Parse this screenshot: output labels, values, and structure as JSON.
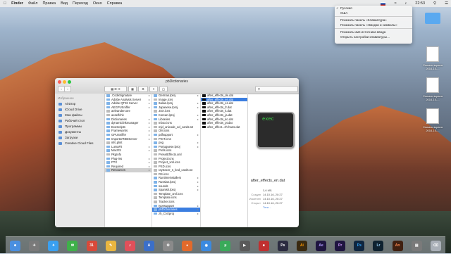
{
  "menubar": {
    "apple": "",
    "items": [
      "Finder",
      "Файл",
      "Правка",
      "Вид",
      "Переход",
      "Окно",
      "Справка"
    ],
    "clock": "22:53"
  },
  "input_menu": {
    "items": [
      "Русская",
      "США"
    ],
    "actions": [
      "Показать панель «Клавиатура»",
      "Показать панель «Эмодзи и символы»",
      "Показать имя источника ввода",
      "Открыть настройки клавиатуры…"
    ]
  },
  "desktop_icons": [
    {
      "label": "Снимок экрана 2016-10-..."
    },
    {
      "label": "Снимок экрана 2016-10-..."
    },
    {
      "label": "Снимок экрана 2016-10-..."
    }
  ],
  "finder": {
    "title": "pbDictionaries",
    "sidebar": {
      "header": "Избранное",
      "items": [
        "AirDrop",
        "iCloud Drive",
        "Мои файлы",
        "Рабочий стол",
        "Программы",
        "Документы",
        "Загрузки",
        "Creative Cloud Files"
      ]
    },
    "col1": [
      ".CodeSignature",
      "Adobe Analysis Server",
      "Adobe QT32 Server",
      "AEGPUSniffer",
      "aeleandercore",
      "aeselfchk",
      "Dictionaries",
      "dynamiclinkmanager",
      "ExeScripts",
      "Frameworks",
      "GPUSniffer",
      "ImporterREDServer",
      "info.plist",
      "LumaFit",
      "MacOS",
      "PkgInfo",
      "Plug-ins",
      "PTX",
      "Required",
      "Resources"
    ],
    "col2": [
      "German.lproj",
      "Image.icns",
      "Italian.lproj",
      "Japanese.lproj",
      "JSX.icns",
      "Korean.lproj",
      "Libraries",
      "Inbox.icns",
      "mjd_unicode_ed_cards.txt",
      "OM.icns",
      "pdfsupport",
      "PICT.icns",
      "png",
      "Portuguese.lproj",
      "Prefs.icns",
      "PresetEffects.xml",
      "Project.icns",
      "Project_xml.icns",
      "PSD.icns",
      "raytracer_s_ked_cards.txt",
      "RS.icns",
      "Runtimeinstallers",
      "Russian.lproj",
      "sounds",
      "Spanish.lproj",
      "Template_xml.icns",
      "Template.icns",
      "Tracker.icns",
      "typesupport",
      "pbDictionaries",
      "zh_CN.lproj"
    ],
    "col3": [
      "after_effects_de.dat",
      "after_effects_en.dat",
      "after_effects_es.dat",
      "after_effects_fr.dat",
      "after_effects_it.dat",
      "after_effects_ja.dat",
      "after_effects_ko.dat",
      "after_effects_pt.dat",
      "after_effect...zh-hans.dat"
    ],
    "selected_col2": "pbDictionaries",
    "selected_col3": "after_effects_en.dat",
    "preview": {
      "icon_text": "exec",
      "name": "after_effects_en.dat",
      "meta": [
        {
          "k": "",
          "v": "3,6 МБ"
        },
        {
          "k": "Создан",
          "v": "14.10.16, 20:27"
        },
        {
          "k": "Изменен",
          "v": "14.10.16, 20:27"
        },
        {
          "k": "Открыт",
          "v": "14.10.16, 20:27"
        },
        {
          "k": "",
          "v": "Теги…"
        }
      ]
    }
  },
  "dock": [
    "Ps",
    "Ai",
    "Ae",
    "Pr",
    "Ps",
    "Lr",
    "An"
  ],
  "colors": {
    "accent": "#3b7ee0",
    "exec_green": "#3ddc4a"
  }
}
